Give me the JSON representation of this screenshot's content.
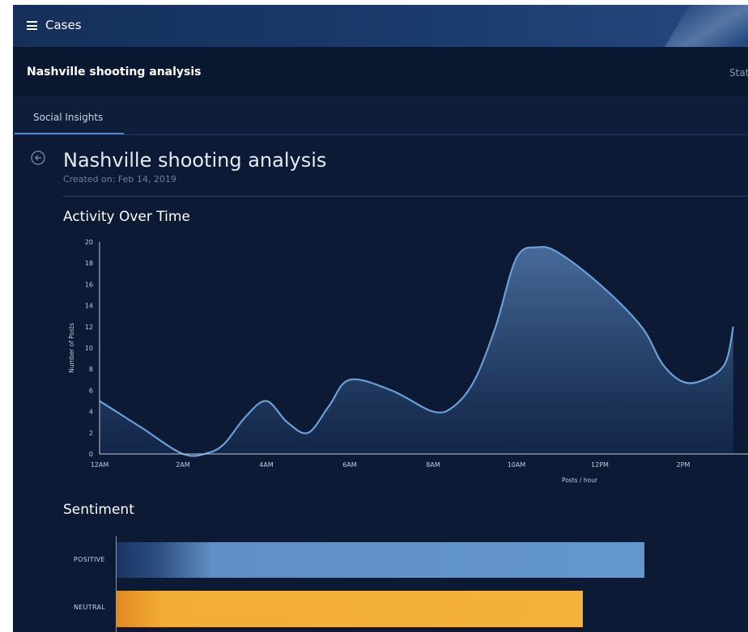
{
  "header": {
    "menu_icon": "hamburger-menu-icon",
    "cases_label": "Cases"
  },
  "case_bar": {
    "title": "Nashville shooting analysis",
    "status_truncated": "Stat"
  },
  "tabs": [
    {
      "label": "Social Insights",
      "active": true
    }
  ],
  "page": {
    "back_icon": "back-arrow-icon",
    "title": "Nashville shooting analysis",
    "created": "Created on: Feb 14, 2019"
  },
  "activity": {
    "title": "Activity Over Time"
  },
  "sentiment": {
    "title": "Sentiment"
  },
  "colors": {
    "line": "#6a9fd8",
    "positive": "#5f8fc4",
    "neutral": "#f2ad35",
    "background": "#0c1a36"
  },
  "chart_data": [
    {
      "type": "area",
      "title": "Activity Over Time",
      "xlabel": "Posts / hour",
      "ylabel": "Number of Posts",
      "ylim": [
        0,
        20
      ],
      "yticks": [
        0,
        2,
        4,
        6,
        8,
        10,
        12,
        14,
        16,
        18,
        20
      ],
      "xtick_labels": [
        "12AM",
        "2AM",
        "4AM",
        "6AM",
        "8AM",
        "10AM",
        "12PM",
        "2PM"
      ],
      "x_hours": [
        0,
        1,
        2,
        2.6,
        3,
        3.5,
        4,
        4.5,
        5,
        5.5,
        6,
        7,
        8,
        8.5,
        9,
        9.5,
        10,
        10.5,
        11,
        12,
        13,
        13.5,
        14,
        14.5,
        15,
        15.2
      ],
      "values": [
        5,
        2.5,
        0,
        0.1,
        1,
        3.5,
        5,
        3,
        2,
        4.5,
        7,
        6,
        4,
        4.5,
        7,
        12,
        18.5,
        19.5,
        19,
        16,
        12,
        8.5,
        6.8,
        7,
        8.5,
        12
      ],
      "grid": false
    },
    {
      "type": "bar",
      "orientation": "horizontal",
      "title": "Sentiment",
      "categories": [
        "POSITIVE",
        "NEUTRAL"
      ],
      "values": [
        0.86,
        0.76
      ]
    }
  ]
}
